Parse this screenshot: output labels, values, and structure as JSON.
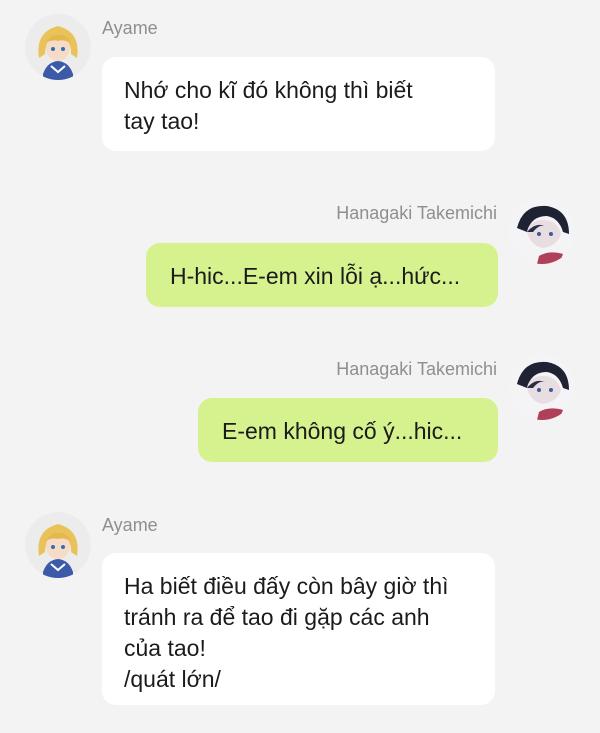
{
  "messages": [
    {
      "direction": "incoming",
      "sender": "Ayame",
      "avatar_icon": "ayame-avatar-icon",
      "text": "Nhớ cho kĩ đó không thì biết\ntay tao!"
    },
    {
      "direction": "outgoing",
      "sender": "Hanagaki Takemichi",
      "avatar_icon": "takemichi-avatar-icon",
      "text": "H-hic...E-em xin lỗi ạ...hức..."
    },
    {
      "direction": "outgoing",
      "sender": "Hanagaki Takemichi",
      "avatar_icon": "takemichi-avatar-icon",
      "text": "E-em không cố ý...hic..."
    },
    {
      "direction": "incoming",
      "sender": "Ayame",
      "avatar_icon": "ayame-avatar-icon",
      "text": "Ha biết điều đấy còn bây giờ thì\ntránh ra để tao đi gặp các anh\ncủa tao!\n/quát lớn/"
    }
  ],
  "colors": {
    "background": "#f3f3f3",
    "incoming_bubble": "#ffffff",
    "outgoing_bubble": "#d6f28e",
    "sender_name": "#8f8f8f",
    "message_text": "#1b1b1b"
  }
}
